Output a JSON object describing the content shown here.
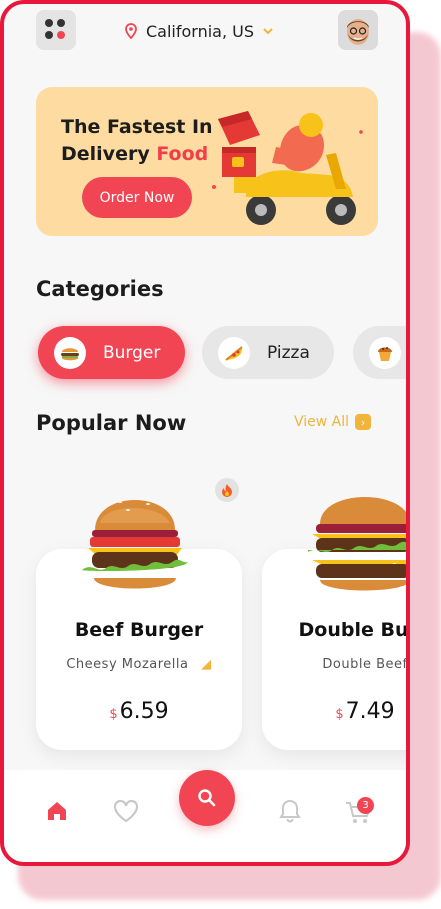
{
  "header": {
    "location": "California, US"
  },
  "banner": {
    "line1": "The Fastest In",
    "line2_prefix": "Delivery",
    "line2_highlight": "Food",
    "button": "Order Now"
  },
  "categories": {
    "title": "Categories",
    "items": [
      {
        "label": "Burger",
        "icon": "burger-icon",
        "active": true
      },
      {
        "label": "Pizza",
        "icon": "pizza-icon",
        "active": false
      },
      {
        "label": "",
        "icon": "muffin-icon",
        "active": false
      }
    ]
  },
  "popular": {
    "title": "Popular Now",
    "view_all": "View All",
    "items": [
      {
        "name": "Beef Burger",
        "subtitle": "Cheesy Mozarella",
        "currency": "$",
        "price": "6.59"
      },
      {
        "name": "Double Burg",
        "subtitle": "Double Beef",
        "currency": "$",
        "price": "7.49"
      }
    ]
  },
  "nav": {
    "cart_badge": "3"
  },
  "colors": {
    "accent": "#f24553",
    "frame": "#e8183d",
    "banner_bg": "#fedba0",
    "view_all": "#f2b43b"
  }
}
